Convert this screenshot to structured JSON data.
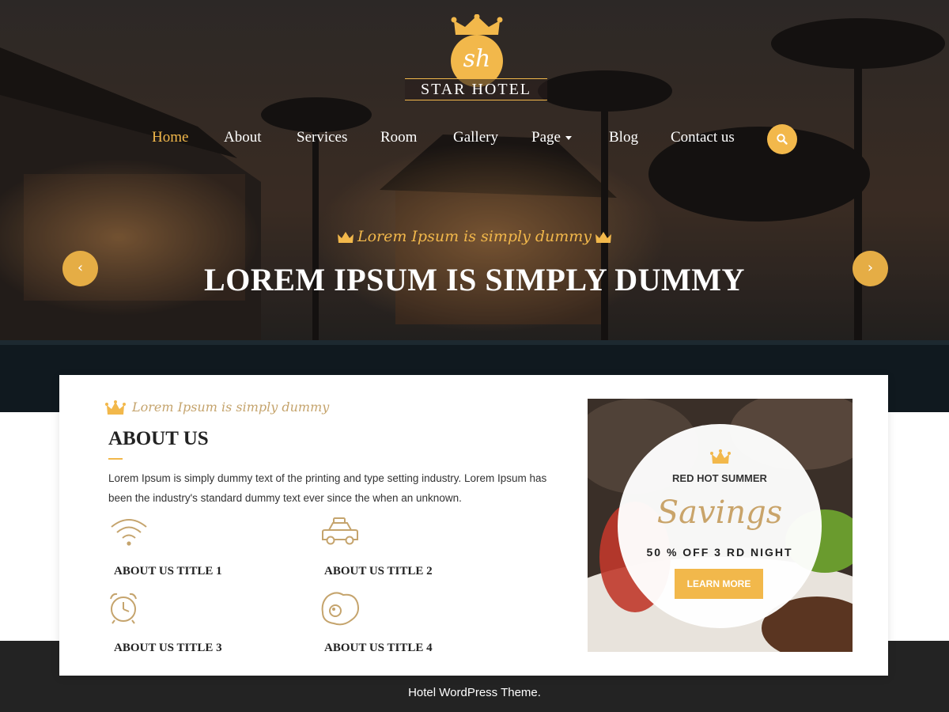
{
  "brand": {
    "monogram": "sh",
    "name": "STAR HOTEL"
  },
  "nav": {
    "items": [
      {
        "label": "Home",
        "active": true
      },
      {
        "label": "About"
      },
      {
        "label": "Services"
      },
      {
        "label": "Room"
      },
      {
        "label": "Gallery"
      },
      {
        "label": "Page",
        "has_dropdown": true
      },
      {
        "label": "Blog"
      },
      {
        "label": "Contact us"
      }
    ],
    "search_icon": "search-icon"
  },
  "slider": {
    "subtitle": "Lorem Ipsum is simply dummy",
    "title": "LOREM IPSUM IS SIMPLY DUMMY",
    "prev_glyph": "‹",
    "next_glyph": "›"
  },
  "about": {
    "subtitle": "Lorem Ipsum is simply dummy",
    "title": "ABOUT US",
    "text": "Lorem Ipsum is simply dummy text of the printing and type setting industry. Lorem Ipsum has been the industry's standard dummy text ever since the when an unknown.",
    "features": [
      {
        "title": "ABOUT US TITLE 1",
        "icon": "wifi-icon"
      },
      {
        "title": "ABOUT US TITLE 2",
        "icon": "car-icon"
      },
      {
        "title": "ABOUT US TITLE 3",
        "icon": "alarm-clock-icon"
      },
      {
        "title": "ABOUT US TITLE 4",
        "icon": "fried-egg-icon"
      }
    ]
  },
  "promo": {
    "label": "RED HOT SUMMER",
    "headline": "Savings",
    "offer": "50 % OFF 3 RD NIGHT",
    "button": "LEARN MORE"
  },
  "footer": {
    "text": "Hotel WordPress Theme."
  },
  "colors": {
    "accent": "#f2b84b",
    "gold_text": "#c5a46d",
    "footer_bg": "#232323",
    "dark_text": "#222222"
  }
}
